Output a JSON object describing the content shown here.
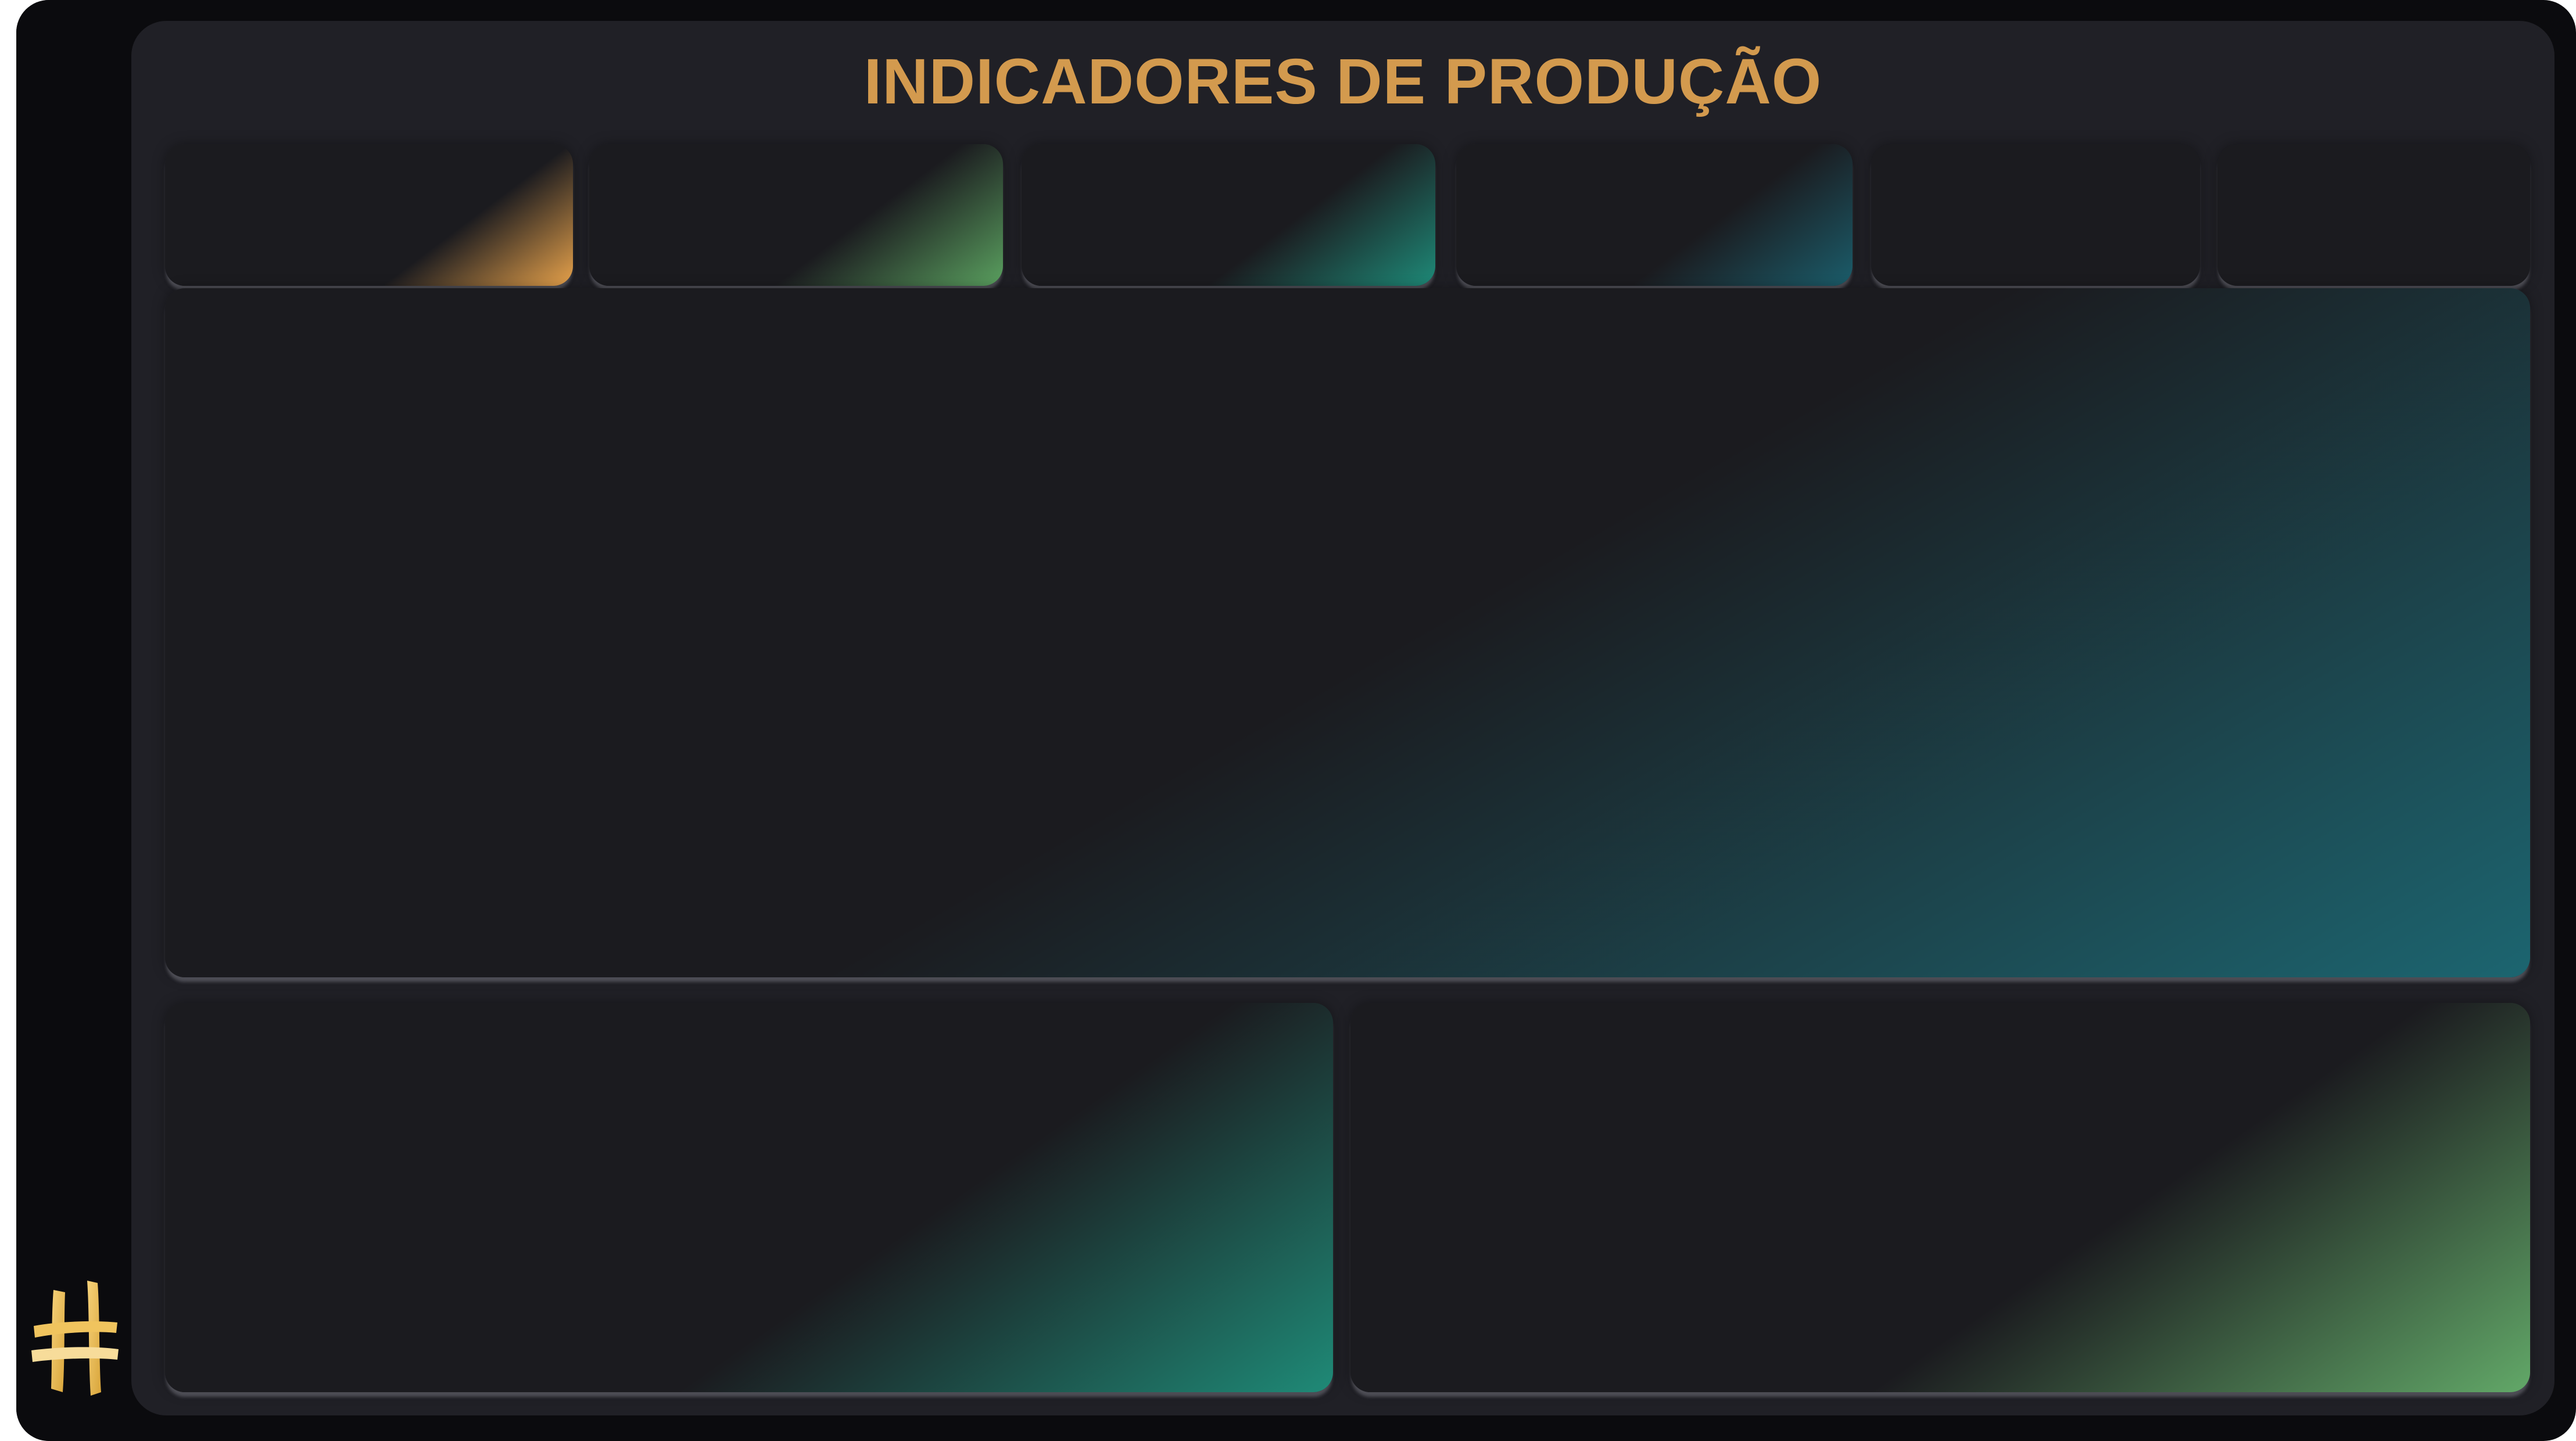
{
  "dashboard": {
    "title": "INDICADORES DE PRODUÇÃO"
  },
  "logo": {
    "icon": "hash-logo-icon",
    "color": "#e8b64a"
  },
  "colors": {
    "background": "#0b0b0e",
    "panel": "#202026",
    "card": "#1b1b1f",
    "title": "#d39a4e",
    "accent_orange": "#e7a24b",
    "accent_green": "#5aa05f",
    "accent_teal": "#1e8a78",
    "accent_blue": "#1b5d6b"
  }
}
